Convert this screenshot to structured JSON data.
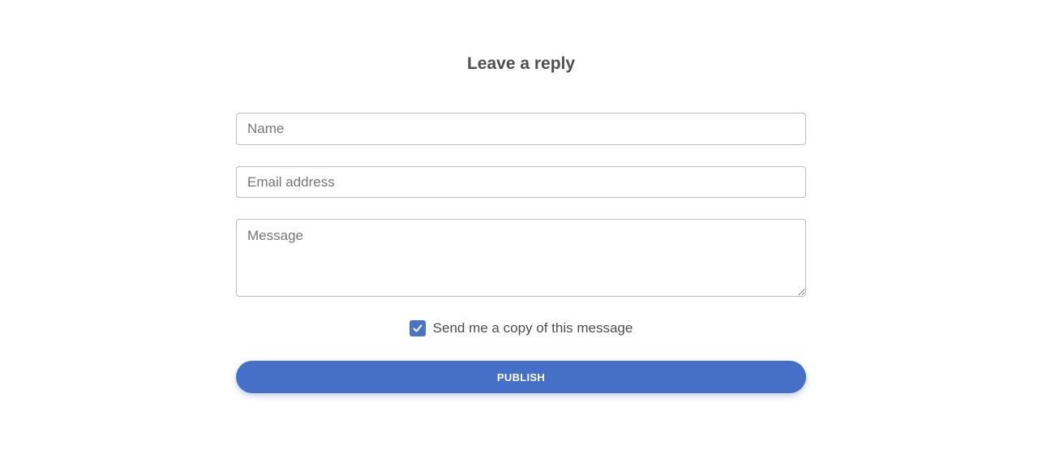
{
  "form": {
    "title": "Leave a reply",
    "name_placeholder": "Name",
    "email_placeholder": "Email address",
    "message_placeholder": "Message",
    "copy_checkbox": {
      "label": "Send me a copy of this message",
      "checked": true,
      "icon": "checkmark-icon"
    },
    "publish_label": "PUBLISH"
  },
  "colors": {
    "accent": "#4670c7",
    "text": "#4f4f4f",
    "border": "#bdbdbd"
  }
}
